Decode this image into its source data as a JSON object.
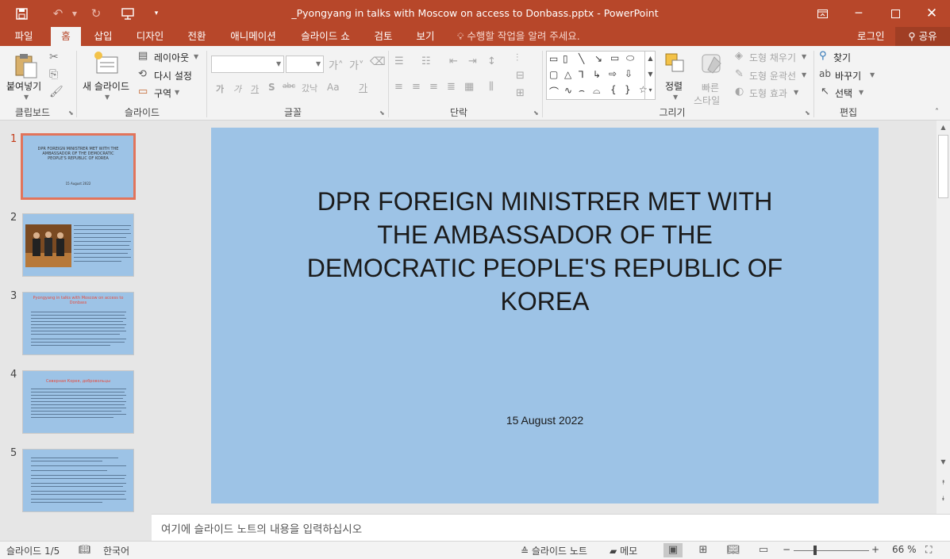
{
  "window": {
    "title": "_Pyongyang in talks with Moscow on access to Donbass.pptx - PowerPoint"
  },
  "qat": {
    "save_icon": "save-icon",
    "undo_icon": "undo-icon",
    "redo_icon": "redo-icon",
    "present_icon": "present-from-start-icon"
  },
  "tabs": [
    {
      "label": "파일"
    },
    {
      "label": "홈"
    },
    {
      "label": "삽입"
    },
    {
      "label": "디자인"
    },
    {
      "label": "전환"
    },
    {
      "label": "애니메이션"
    },
    {
      "label": "슬라이드 쇼"
    },
    {
      "label": "검토"
    },
    {
      "label": "보기"
    }
  ],
  "tellme": "수행할 작업을 알려 주세요.",
  "signin": "로그인",
  "share": "공유",
  "ribbon": {
    "clipboard": {
      "label": "클립보드",
      "paste": "붙여넣기"
    },
    "slides": {
      "label": "슬라이드",
      "new_slide": "새 슬라이드",
      "layout": "레이아웃",
      "reset": "다시 설정",
      "section": "구역"
    },
    "font": {
      "label": "글꼴"
    },
    "paragraph": {
      "label": "단락"
    },
    "drawing": {
      "label": "그리기",
      "arrange": "정렬",
      "quick_styles_1": "빠른",
      "quick_styles_2": "스타일",
      "fill": "도형 채우기",
      "outline": "도형 윤곽선",
      "effects": "도형 효과"
    },
    "editing": {
      "label": "편집",
      "find": "찾기",
      "replace": "바꾸기",
      "select": "선택"
    }
  },
  "thumbnails": [
    {
      "num": "1",
      "title": "DPR FOREIGN MINISTRER MET WITH THE AMBASSADOR OF THE DEMOCRATIC PEOPLE'S REPUBLIC OF KOREA",
      "date": "15 August 2022"
    },
    {
      "num": "2"
    },
    {
      "num": "3",
      "title": "Pyongyang in talks with Moscow on access to Donbass"
    },
    {
      "num": "4",
      "title": "Северная Корея, добровольцы"
    },
    {
      "num": "5"
    }
  ],
  "slide": {
    "title": "DPR FOREIGN MINISTRER MET WITH THE AMBASSADOR OF THE DEMOCRATIC PEOPLE'S REPUBLIC OF KOREA",
    "date": "15 August 2022",
    "background": "#9dc3e6"
  },
  "notes_placeholder": "여기에 슬라이드 노트의 내용을 입력하십시오",
  "status": {
    "slide_counter": "슬라이드 1/5",
    "language": "한국어",
    "notes": "슬라이드 노트",
    "comments": "메모",
    "zoom": "66 %"
  },
  "colors": {
    "accent": "#b7472a",
    "slide_bg": "#9dc3e6",
    "selected_thumb_border": "#e2745b"
  }
}
